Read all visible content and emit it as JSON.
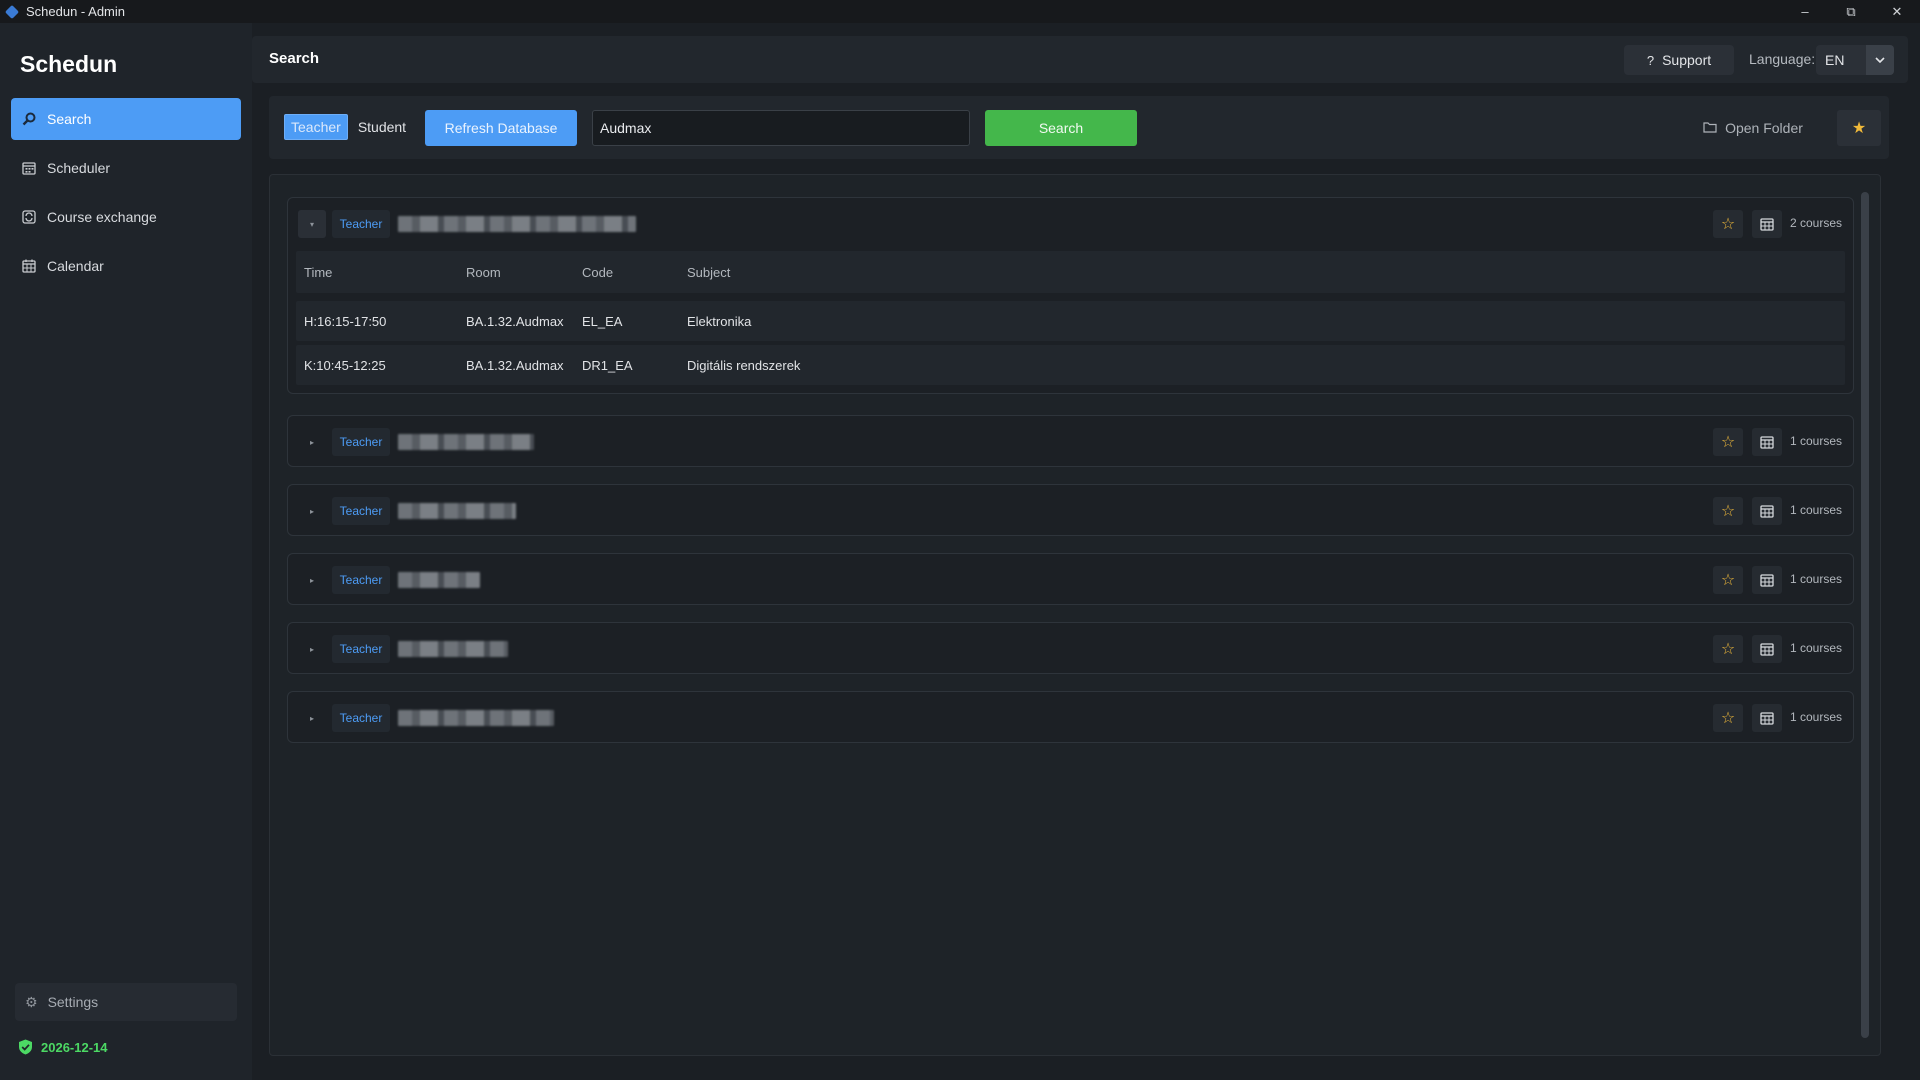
{
  "window": {
    "title": "Schedun - Admin"
  },
  "sidebar": {
    "brand": "Schedun",
    "items": [
      {
        "label": "Search",
        "icon": "search-icon",
        "active": true
      },
      {
        "label": "Scheduler",
        "icon": "calendar-grid-icon",
        "active": false
      },
      {
        "label": "Course exchange",
        "icon": "exchange-icon",
        "active": false
      },
      {
        "label": "Calendar",
        "icon": "calendar-icon",
        "active": false
      }
    ],
    "settings_label": "Settings",
    "license_date": "2026-12-14"
  },
  "header": {
    "title": "Search",
    "support_label": "Support",
    "language_label": "Language:",
    "language_value": "EN"
  },
  "toolbar": {
    "mode_options": [
      "Teacher",
      "Student"
    ],
    "mode_selected": "Teacher",
    "refresh_label": "Refresh Database",
    "search_value": "Audmax",
    "search_label": "Search",
    "open_folder_label": "Open Folder"
  },
  "results": {
    "columns": [
      "Time",
      "Room",
      "Code",
      "Subject"
    ],
    "groups": [
      {
        "role": "Teacher",
        "count_label": "2 courses",
        "expanded": true,
        "rows": [
          {
            "time": "H:16:15-17:50",
            "room": "BA.1.32.Audmax",
            "code": "EL_EA",
            "subject": "Elektronika"
          },
          {
            "time": "K:10:45-12:25",
            "room": "BA.1.32.Audmax",
            "code": "DR1_EA",
            "subject": "Digitális rendszerek"
          }
        ]
      },
      {
        "role": "Teacher",
        "count_label": "1 courses",
        "expanded": false
      },
      {
        "role": "Teacher",
        "count_label": "1 courses",
        "expanded": false
      },
      {
        "role": "Teacher",
        "count_label": "1 courses",
        "expanded": false
      },
      {
        "role": "Teacher",
        "count_label": "1 courses",
        "expanded": false
      },
      {
        "role": "Teacher",
        "count_label": "1 courses",
        "expanded": false
      }
    ]
  },
  "colors": {
    "accent": "#4d9cf5",
    "success": "#44b74b",
    "star": "#f0b93a",
    "license_ok": "#4cd964"
  }
}
